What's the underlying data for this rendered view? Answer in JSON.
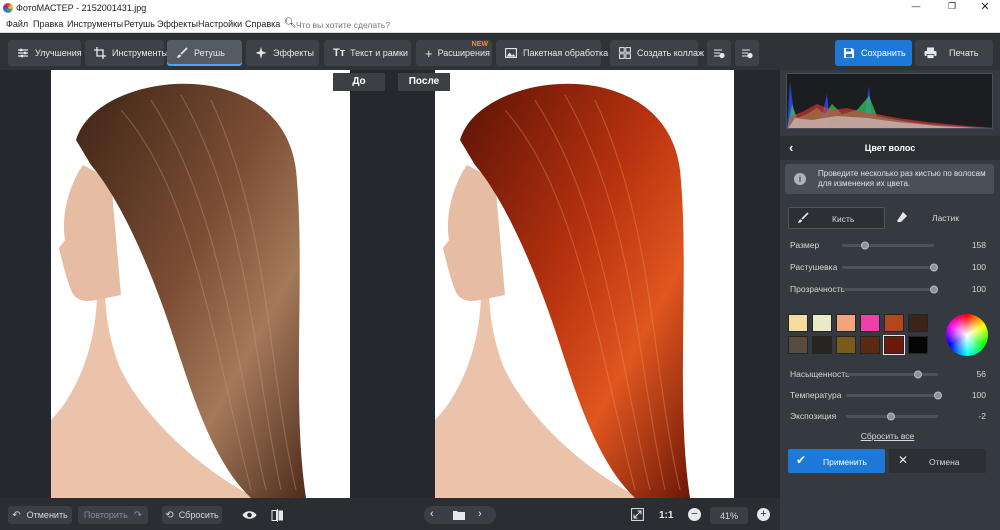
{
  "titlebar": {
    "title": "ФотоМАСТЕР - 2152001431.jpg"
  },
  "menu": {
    "items": [
      "Файл",
      "Правка",
      "Инструменты",
      "Ретушь",
      "Эффекты",
      "Настройки",
      "Справка"
    ],
    "search_placeholder": "Что вы хотите сделать?"
  },
  "toolbar": {
    "tabs": [
      "Улучшения",
      "Инструменты",
      "Ретушь",
      "Эффекты",
      "Текст и рамки",
      "Расширения",
      "Пакетная обработка",
      "Создать коллаж"
    ],
    "new_badge": "NEW",
    "save_label": "Сохранить",
    "print_label": "Печать",
    "accent": "#1e78d7"
  },
  "canvas": {
    "before_label": "До",
    "after_label": "После"
  },
  "bottom": {
    "undo_label": "Отменить",
    "redo_label": "Повторить",
    "reset_label": "Сбросить",
    "zoom_11": "1:1",
    "zoom_value": "41%"
  },
  "panel": {
    "title": "Цвет волос",
    "hint": "Проведите несколько раз кистью по волосам для изменения их цвета.",
    "brush_label": "Кисть",
    "eraser_label": "Ластик",
    "sliders_top": [
      {
        "label": "Размер",
        "value": "158",
        "level": 0.25
      },
      {
        "label": "Растушевка",
        "value": "100",
        "level": 1.0
      },
      {
        "label": "Прозрачность",
        "value": "100",
        "level": 1.0
      }
    ],
    "swatches": [
      "#f6dc9c",
      "#ece9c8",
      "#f2a57b",
      "#ef3fa8",
      "#b5451b",
      "#3d2418",
      "#5a4b3f",
      "#2a2420",
      "#7b5a1c",
      "#5c2a10",
      "#6e1a0a",
      "#050505"
    ],
    "selected_swatch": 10,
    "sliders_bottom": [
      {
        "label": "Насыщенность",
        "value": "56",
        "level": 0.78
      },
      {
        "label": "Температура",
        "value": "100",
        "level": 1.0
      },
      {
        "label": "Экспозиция",
        "value": "-2",
        "level": 0.49
      }
    ],
    "reset_all_label": "Сбросить все",
    "apply_label": "Применить",
    "cancel_label": "Отмена"
  }
}
